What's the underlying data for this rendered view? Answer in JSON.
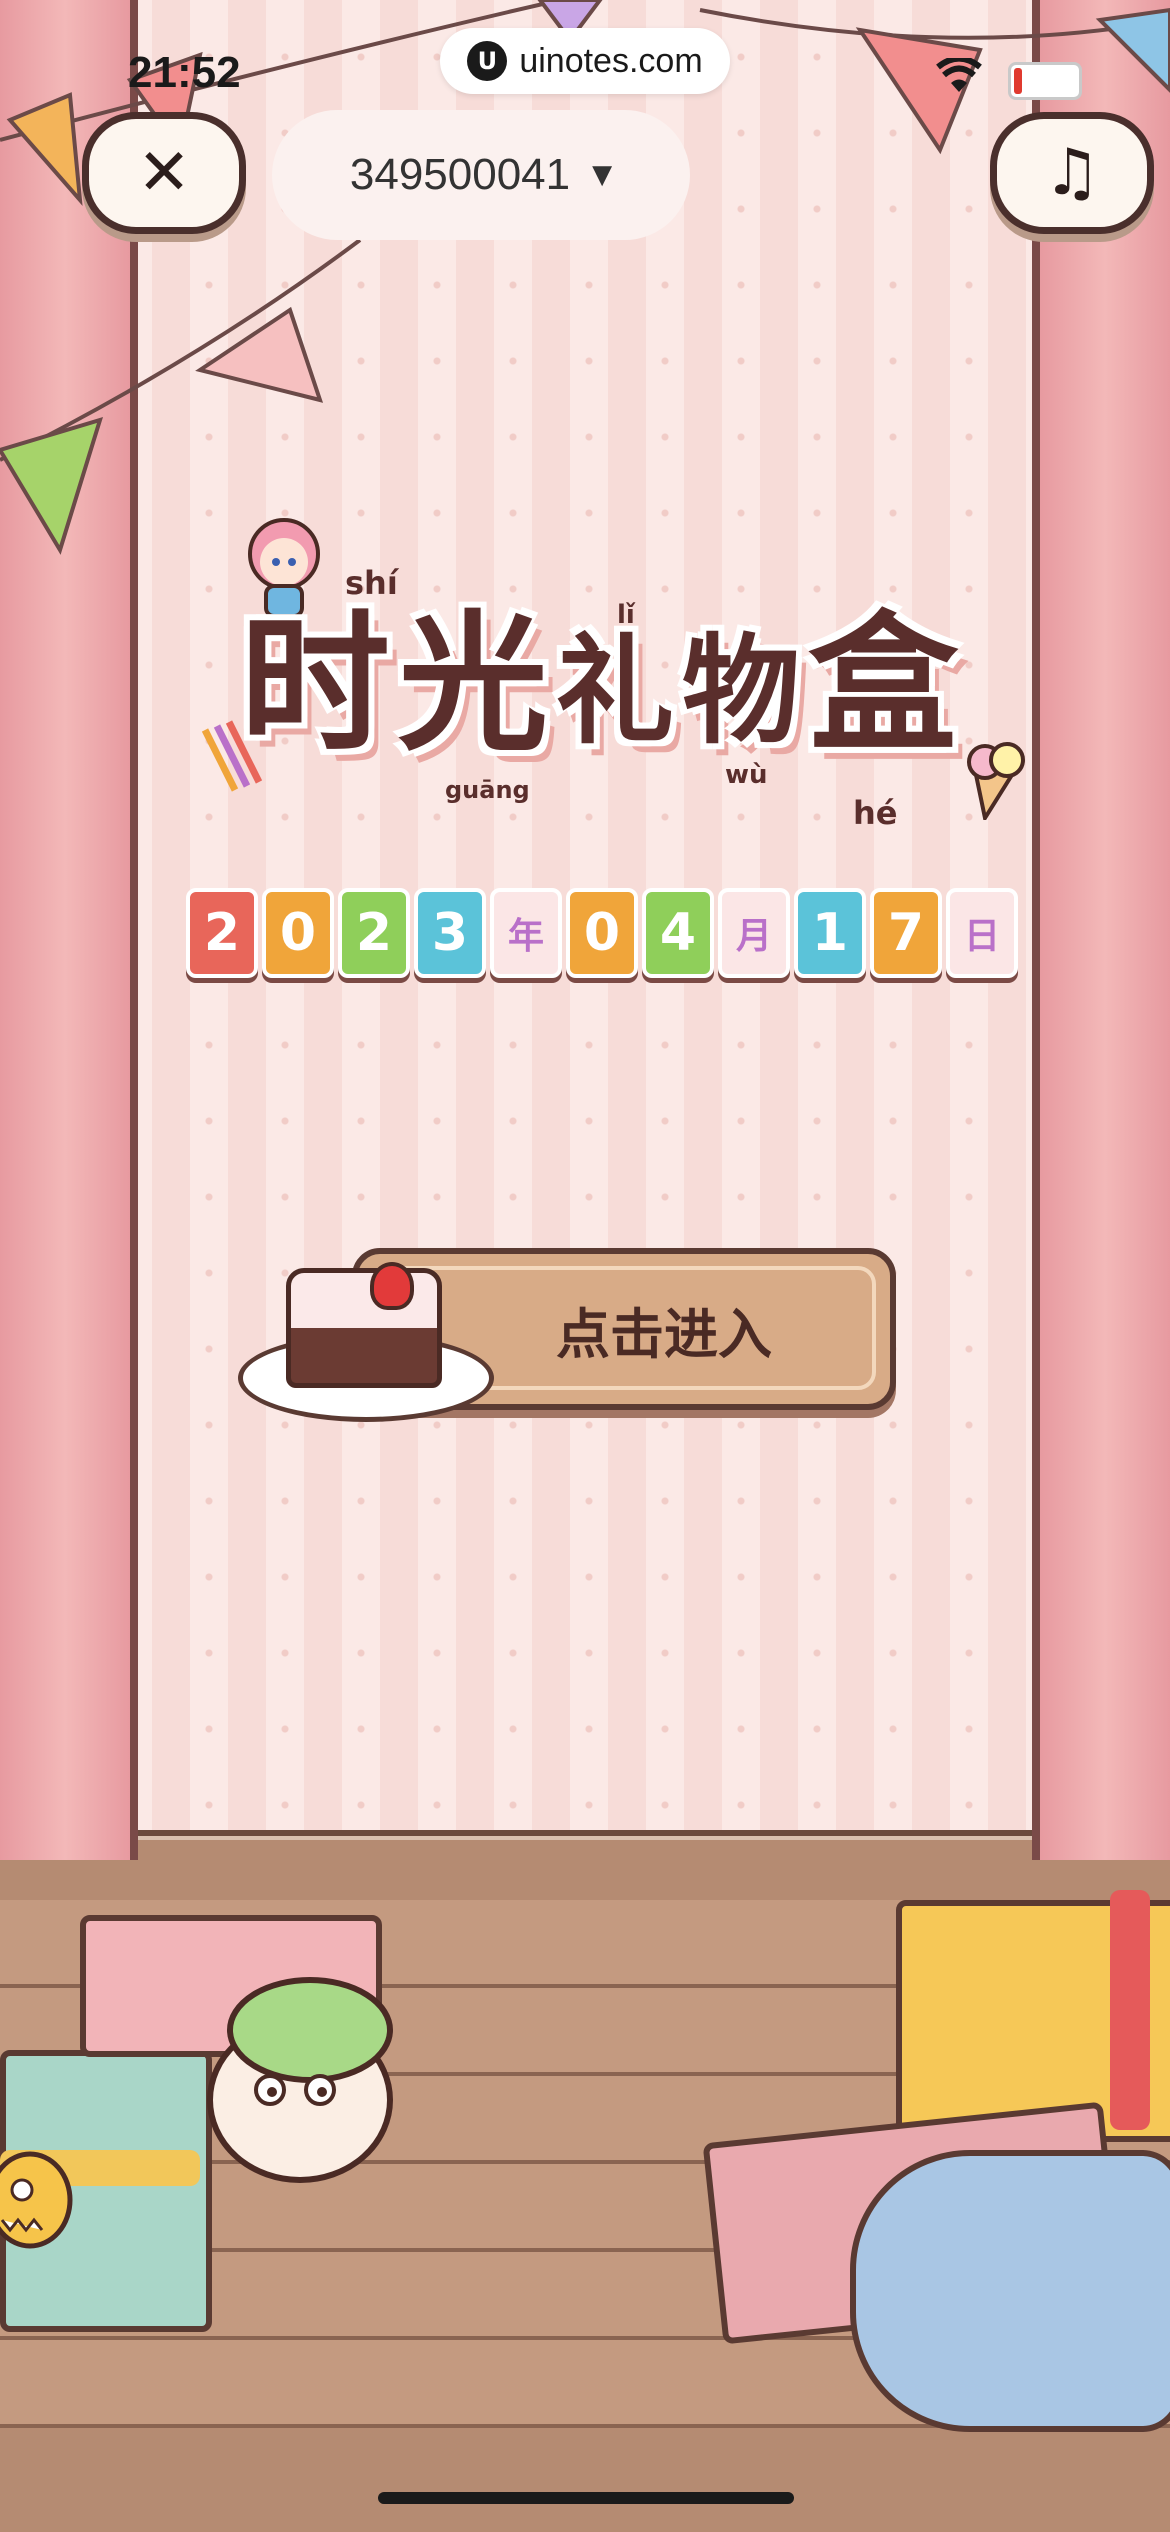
{
  "status_bar": {
    "time": "21:52",
    "url": "uinotes.com",
    "url_logo_icon": "uinotes-logo-icon",
    "wifi_icon": "wifi-icon",
    "battery_icon": "battery-low-icon"
  },
  "header": {
    "close_icon": "close-icon",
    "close_glyph": "✕",
    "music_icon": "music-note-icon",
    "music_glyph": "♫",
    "account_id": "349500041",
    "dropdown_glyph": "▼"
  },
  "title": {
    "chars": [
      "时",
      "光",
      "礼",
      "物",
      "盒"
    ],
    "pinyin": {
      "shi": "shí",
      "guang": "guāng",
      "li": "lǐ",
      "wu": "wù",
      "he": "hé"
    }
  },
  "date_tiles": [
    {
      "text": "2",
      "color": "#e8665a"
    },
    {
      "text": "0",
      "color": "#f0a53a"
    },
    {
      "text": "2",
      "color": "#8fcf5a"
    },
    {
      "text": "3",
      "color": "#5bc3d9"
    },
    {
      "text": "年",
      "color": "#b970c9"
    },
    {
      "text": "0",
      "color": "#f0a53a"
    },
    {
      "text": "4",
      "color": "#8fcf5a"
    },
    {
      "text": "月",
      "color": "#b970c9"
    },
    {
      "text": "1",
      "color": "#5bc3d9"
    },
    {
      "text": "7",
      "color": "#f0a53a"
    },
    {
      "text": "日",
      "color": "#b970c9"
    }
  ],
  "enter_button": {
    "label": "点击进入"
  },
  "colors": {
    "title_brown": "#5a2e2c",
    "button_tan": "#d8ab87",
    "curtain_pink": "#f3b8b8"
  }
}
